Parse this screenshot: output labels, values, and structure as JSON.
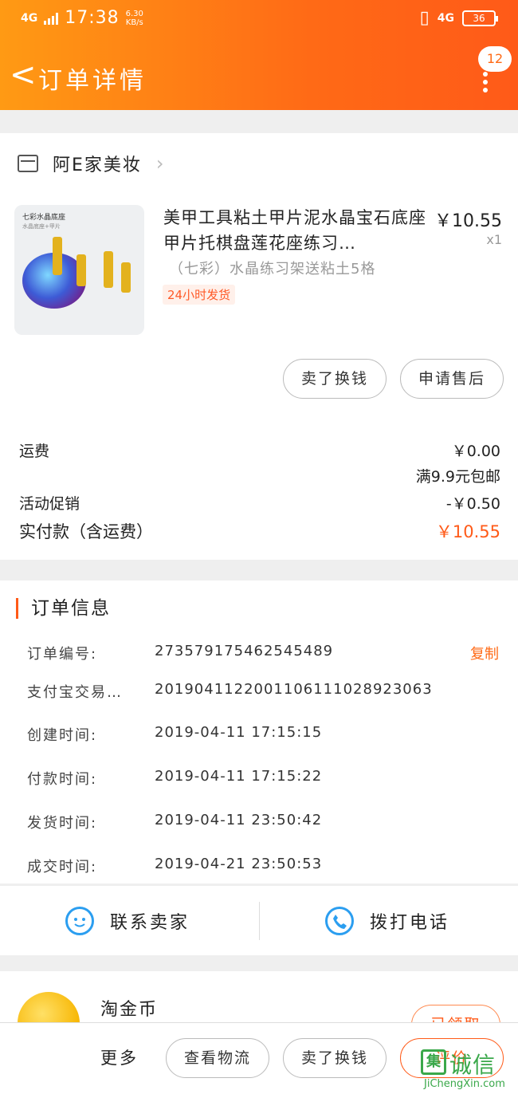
{
  "status_bar": {
    "network": "4G",
    "time": "17:38",
    "speed": "6.30",
    "speed_unit": "KB/s",
    "network_right": "4G",
    "battery": "36"
  },
  "nav": {
    "back_label": "<",
    "title": "订单详情",
    "badge_count": "12"
  },
  "shop": {
    "name": "阿E家美妆"
  },
  "product": {
    "image_label": "七彩水晶底座",
    "image_sub": "水晶底座+甲片",
    "title": "美甲工具粘土甲片泥水晶宝石底座甲片托棋盘莲花座练习…",
    "price": "￥10.55",
    "qty": "x1",
    "sku": "（七彩）水晶练习架送粘土5格",
    "tag": "24小时发货"
  },
  "item_actions": {
    "refund": "卖了换钱",
    "after_sale": "申请售后"
  },
  "fees": {
    "shipping_label": "运费",
    "shipping_value": "￥0.00",
    "shipping_note": "满9.9元包邮",
    "promo_label": "活动促销",
    "promo_value": "-￥0.50",
    "paid_label": "实付款（含运费）",
    "paid_value": "￥10.55"
  },
  "order_info": {
    "title": "订单信息",
    "copy_label": "复制",
    "rows": [
      {
        "key": "订单编号:",
        "value": "273579175462545489"
      },
      {
        "key": "支付宝交易…",
        "value": "2019041122001106111028923063"
      },
      {
        "key": "创建时间:",
        "value": "2019-04-11 17:15:15"
      },
      {
        "key": "付款时间:",
        "value": "2019-04-11 17:15:22"
      },
      {
        "key": "发货时间:",
        "value": "2019-04-11 23:50:42"
      },
      {
        "key": "成交时间:",
        "value": "2019-04-21 23:50:53"
      }
    ]
  },
  "contact": {
    "seller": "联系卖家",
    "call": "拨打电话"
  },
  "coin": {
    "label": "淘金币",
    "action": "已领取"
  },
  "bottom": {
    "more": "更多",
    "logistics": "查看物流",
    "resell": "卖了换钱",
    "review": "评价"
  },
  "watermark": {
    "box": "集",
    "text": "诚信",
    "url": "JiChengXin.com"
  },
  "colors": {
    "accent": "#ff5a18",
    "header_start": "#ff9a14",
    "link_blue": "#2b9ef0"
  }
}
